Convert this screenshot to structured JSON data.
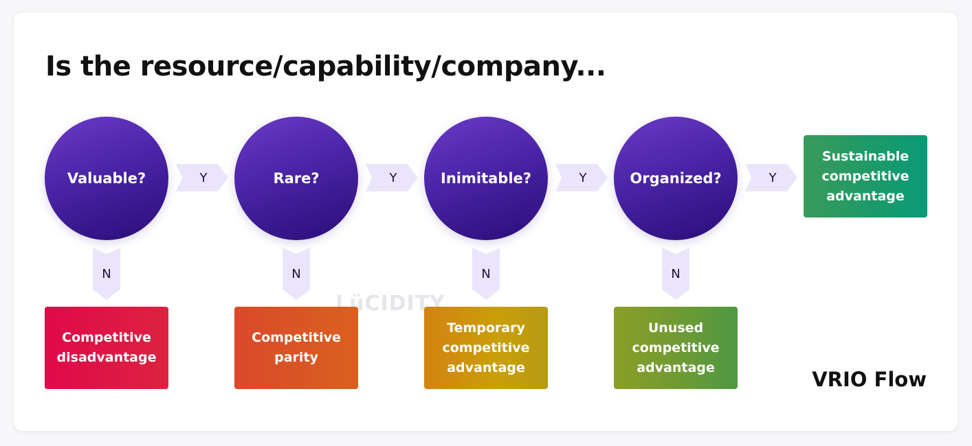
{
  "title": "Is the resource/capability/company...",
  "subtitle": "VRIO Flow",
  "watermark": "LüCIDITY",
  "questions": [
    {
      "label": "Valuable?",
      "yes": "Y",
      "no": "N"
    },
    {
      "label": "Rare?",
      "yes": "Y",
      "no": "N"
    },
    {
      "label": "Inimitable?",
      "yes": "Y",
      "no": "N"
    },
    {
      "label": "Organized?",
      "yes": "Y",
      "no": "N"
    }
  ],
  "outcomes": {
    "no": [
      {
        "label": "Competitive disadvantage",
        "color": "#e0094a"
      },
      {
        "label": "Competitive parity",
        "color": "#d9542a"
      },
      {
        "label": "Temporary competitive advantage",
        "color": "#d0920c"
      },
      {
        "label": "Unused competitive advantage",
        "color": "#6f9a34"
      }
    ],
    "final": {
      "label": "Sustainable competitive advantage",
      "color": "#1e9a68"
    }
  },
  "colors": {
    "circle": "#4a24a6",
    "connector": "#ebe5fb",
    "connector_text": "#1a1040"
  }
}
